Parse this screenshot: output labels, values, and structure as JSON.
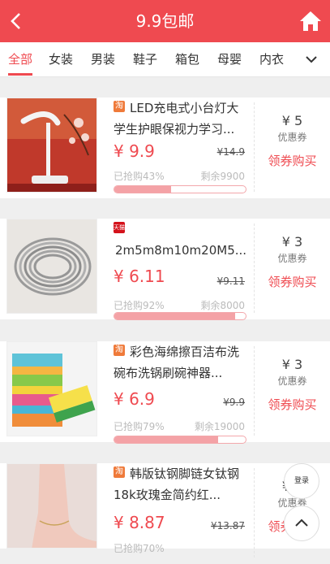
{
  "header": {
    "title": "9.9包邮",
    "back_icon": "chevron-left-icon",
    "home_icon": "home-icon"
  },
  "tabs": [
    {
      "label": "全部",
      "active": true
    },
    {
      "label": "女装"
    },
    {
      "label": "男装"
    },
    {
      "label": "鞋子"
    },
    {
      "label": "箱包"
    },
    {
      "label": "母婴"
    },
    {
      "label": "内衣"
    }
  ],
  "products": [
    {
      "badge": "淘",
      "name": "LED充电式小台灯大学生护眼保视力学习...",
      "price": "¥ 9.9",
      "original": "¥14.9",
      "sold": "已抢购43%",
      "progress": 0.43,
      "remain": "剩余9900",
      "coupon_amount": "¥ 5",
      "coupon_label": "优惠券",
      "coupon_action": "领券购买"
    },
    {
      "badge": "天猫",
      "name": "2m5m8m10m20M5...",
      "price": "¥ 6.11",
      "original": "¥9.11",
      "sold": "已抢购92%",
      "progress": 0.92,
      "remain": "剩余8000",
      "coupon_amount": "¥ 3",
      "coupon_label": "优惠券",
      "coupon_action": "领券购买"
    },
    {
      "badge": "淘",
      "name": "彩色海绵擦百洁布洗碗布洗锅刷碗神器...",
      "price": "¥ 6.9",
      "original": "¥9.9",
      "sold": "已抢购79%",
      "progress": 0.79,
      "remain": "剩余19000",
      "coupon_amount": "¥ 3",
      "coupon_label": "优惠券",
      "coupon_action": "领券购买"
    },
    {
      "badge": "淘",
      "name": "韩版钛钢脚链女钛钢18k玫瑰金简约红...",
      "price": "¥ 8.87",
      "original": "¥13.87",
      "sold": "已抢购70%",
      "progress": 0.7,
      "remain": "",
      "coupon_amount": "¥ 5",
      "coupon_label": "优惠券",
      "coupon_action": "领券购买"
    }
  ],
  "float": {
    "login_label": "登录",
    "top_icon": "chevron-up-icon"
  }
}
